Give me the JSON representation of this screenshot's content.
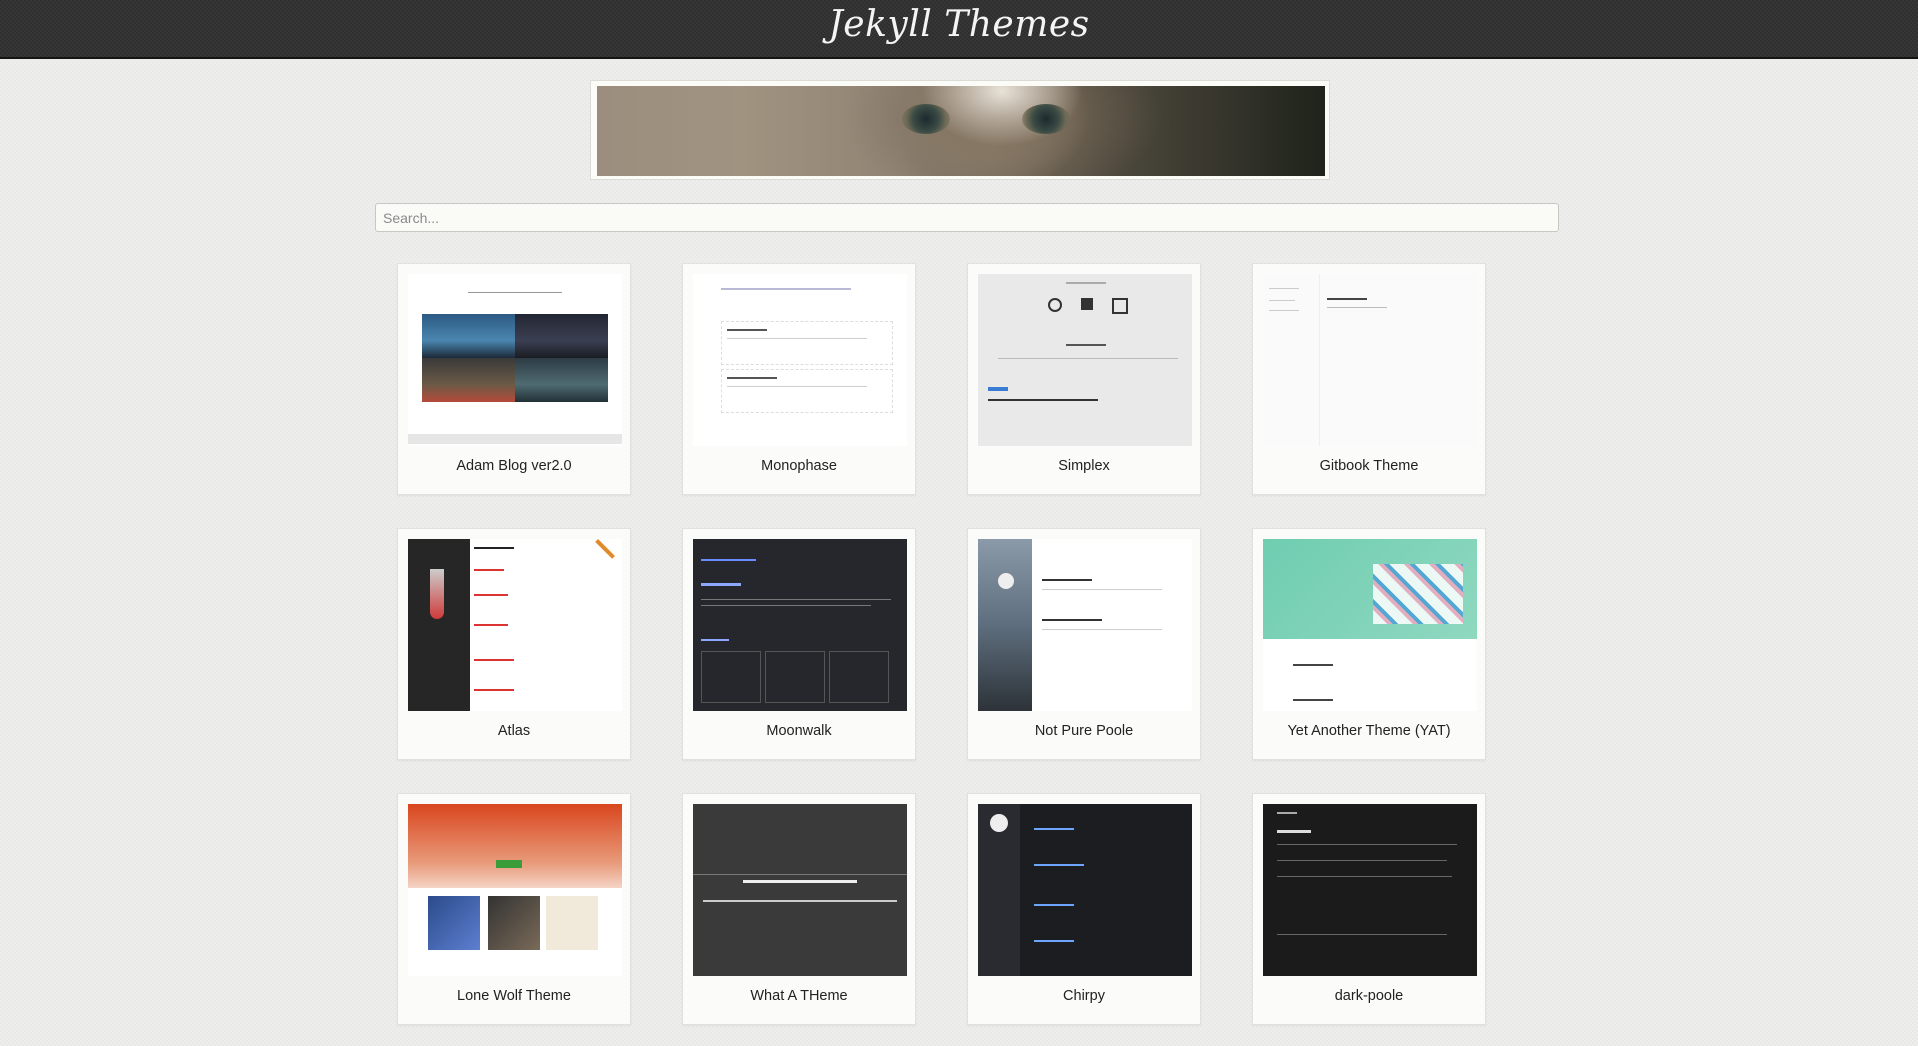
{
  "header": {
    "title": "Jekyll Themes"
  },
  "search": {
    "placeholder": "Search..."
  },
  "themes": [
    {
      "name": "Adam Blog ver2.0"
    },
    {
      "name": "Monophase"
    },
    {
      "name": "Simplex"
    },
    {
      "name": "Gitbook Theme"
    },
    {
      "name": "Atlas"
    },
    {
      "name": "Moonwalk"
    },
    {
      "name": "Not Pure Poole"
    },
    {
      "name": "Yet Another Theme (YAT)"
    },
    {
      "name": "Lone Wolf Theme"
    },
    {
      "name": "What A THeme"
    },
    {
      "name": "Chirpy"
    },
    {
      "name": "dark-poole"
    }
  ]
}
